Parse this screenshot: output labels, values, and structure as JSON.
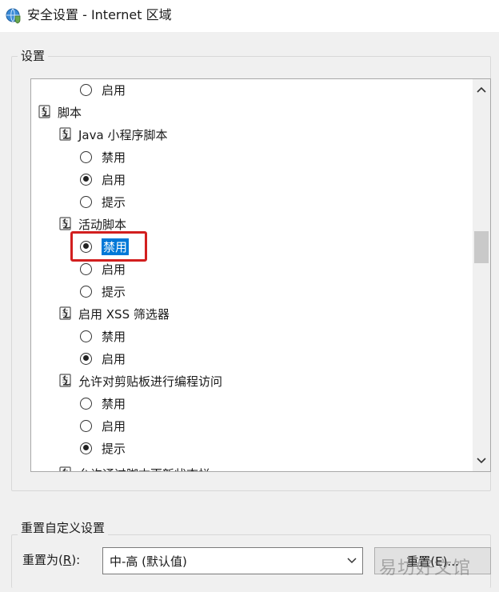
{
  "window": {
    "title": "安全设置 - Internet 区域"
  },
  "settings_group": {
    "label": "设置"
  },
  "tree": [
    {
      "kind": "option",
      "indent": 2,
      "label": "启用",
      "checked": false
    },
    {
      "kind": "category",
      "indent": 0,
      "label": "脚本"
    },
    {
      "kind": "category",
      "indent": 1,
      "label": "Java 小程序脚本"
    },
    {
      "kind": "option",
      "indent": 2,
      "label": "禁用",
      "checked": false
    },
    {
      "kind": "option",
      "indent": 2,
      "label": "启用",
      "checked": true
    },
    {
      "kind": "option",
      "indent": 2,
      "label": "提示",
      "checked": false
    },
    {
      "kind": "category",
      "indent": 1,
      "label": "活动脚本"
    },
    {
      "kind": "option",
      "indent": 2,
      "label": "禁用",
      "checked": true,
      "selected": true
    },
    {
      "kind": "option",
      "indent": 2,
      "label": "启用",
      "checked": false
    },
    {
      "kind": "option",
      "indent": 2,
      "label": "提示",
      "checked": false
    },
    {
      "kind": "category",
      "indent": 1,
      "label": "启用 XSS 筛选器"
    },
    {
      "kind": "option",
      "indent": 2,
      "label": "禁用",
      "checked": false
    },
    {
      "kind": "option",
      "indent": 2,
      "label": "启用",
      "checked": true
    },
    {
      "kind": "category",
      "indent": 1,
      "label": "允许对剪贴板进行编程访问"
    },
    {
      "kind": "option",
      "indent": 2,
      "label": "禁用",
      "checked": false
    },
    {
      "kind": "option",
      "indent": 2,
      "label": "启用",
      "checked": false
    },
    {
      "kind": "option",
      "indent": 2,
      "label": "提示",
      "checked": true
    },
    {
      "kind": "category",
      "indent": 1,
      "label": "允许通过脚本更新状态栏"
    }
  ],
  "reset_group": {
    "label": "重置自定义设置",
    "reset_to_label": "重置为",
    "reset_to_hotkey": "R",
    "reset_to_suffix": "):",
    "selected_level": "中-高 (默认值)",
    "reset_button_label": "重置(E)..."
  },
  "watermark": {
    "text": "易坊好文馆"
  },
  "colors": {
    "selection": "#0078d7",
    "highlight_border": "#d21f1f"
  }
}
